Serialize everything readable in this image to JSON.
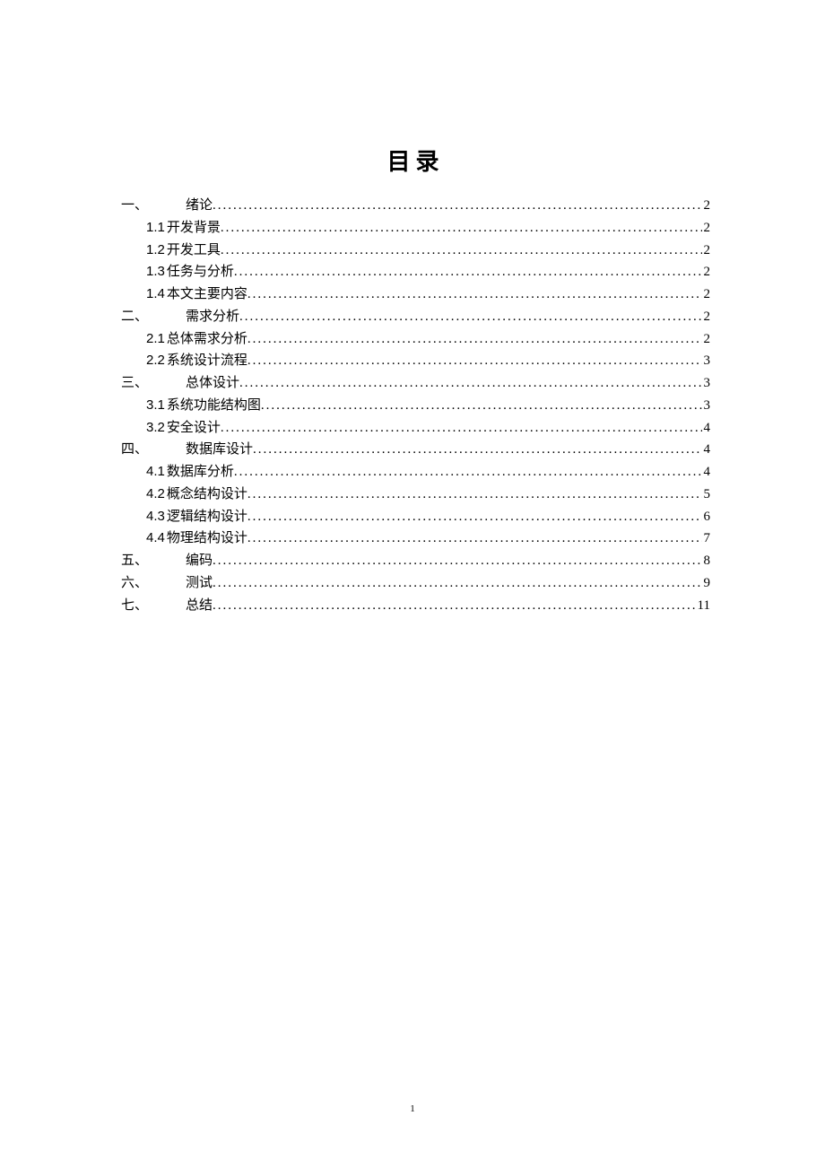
{
  "title": "目录",
  "page_number": "1",
  "toc": [
    {
      "level": 1,
      "num": "一、",
      "text": "绪论",
      "page": "2"
    },
    {
      "level": 2,
      "num": "1.1",
      "text": "开发背景",
      "page": "2"
    },
    {
      "level": 2,
      "num": "1.2",
      "text": "开发工具",
      "page": "2"
    },
    {
      "level": 2,
      "num": "1.3",
      "text": "任务与分析",
      "page": "2"
    },
    {
      "level": 2,
      "num": "1.4",
      "text": "本文主要内容",
      "page": "2"
    },
    {
      "level": 1,
      "num": "二、",
      "text": "需求分析",
      "page": "2"
    },
    {
      "level": 2,
      "num": "2.1",
      "text": "总体需求分析",
      "page": "2"
    },
    {
      "level": 2,
      "num": "2.2",
      "text": "系统设计流程",
      "page": "3"
    },
    {
      "level": 1,
      "num": "三、",
      "text": "总体设计",
      "page": "3"
    },
    {
      "level": 2,
      "num": "3.1",
      "text": "系统功能结构图",
      "page": "3"
    },
    {
      "level": 2,
      "num": "3.2",
      "text": "安全设计",
      "page": "4"
    },
    {
      "level": 1,
      "num": "四、",
      "text": "数据库设计",
      "page": "4"
    },
    {
      "level": 2,
      "num": "4.1",
      "text": "数据库分析",
      "page": "4"
    },
    {
      "level": 2,
      "num": "4.2",
      "text": "概念结构设计",
      "page": "5"
    },
    {
      "level": 2,
      "num": "4.3",
      "text": "逻辑结构设计",
      "page": "6"
    },
    {
      "level": 2,
      "num": "4.4",
      "text": "物理结构设计",
      "page": "7"
    },
    {
      "level": 1,
      "num": "五、",
      "text": "编码",
      "page": "8"
    },
    {
      "level": 1,
      "num": "六、",
      "text": "测试",
      "page": "9"
    },
    {
      "level": 1,
      "num": "七、",
      "text": "总结",
      "page": "11"
    }
  ]
}
